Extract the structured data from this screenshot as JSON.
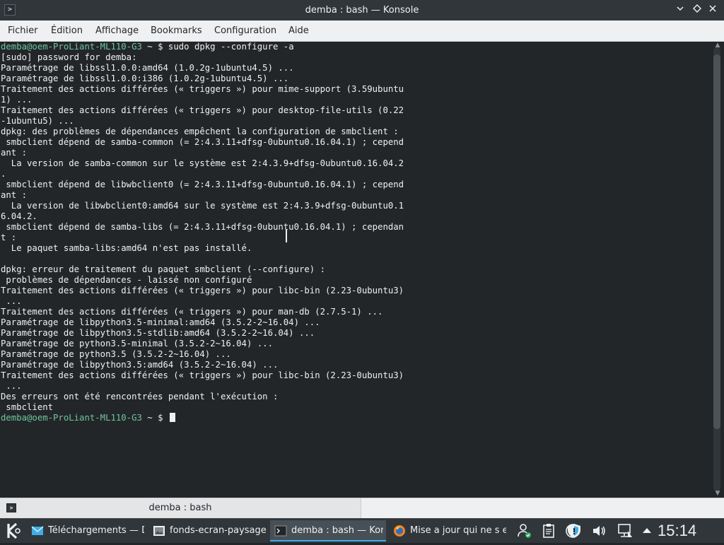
{
  "window": {
    "title": "demba : bash — Konsole",
    "app_icon": "terminal-icon",
    "controls": [
      "chevron-down-icon",
      "keep-above-icon",
      "close-icon"
    ]
  },
  "menubar": {
    "items": [
      "Fichier",
      "Édition",
      "Affichage",
      "Bookmarks",
      "Configuration",
      "Aide"
    ]
  },
  "terminal": {
    "prompt_user_host": "demba@oem-ProLiant-ML110-G3",
    "prompt_suffix": " ~ $ ",
    "command": "sudo dpkg --configure -a",
    "output_lines": [
      "[sudo] password for demba:",
      "Paramétrage de libssl1.0.0:amd64 (1.0.2g-1ubuntu4.5) ...",
      "Paramétrage de libssl1.0.0:i386 (1.0.2g-1ubuntu4.5) ...",
      "Traitement des actions différées (« triggers ») pour mime-support (3.59ubuntu",
      "1) ...",
      "Traitement des actions différées (« triggers ») pour desktop-file-utils (0.22",
      "-1ubuntu5) ...",
      "dpkg: des problèmes de dépendances empêchent la configuration de smbclient :",
      " smbclient dépend de samba-common (= 2:4.3.11+dfsg-0ubuntu0.16.04.1) ; cepend",
      "ant :",
      "  La version de samba-common sur le système est 2:4.3.9+dfsg-0ubuntu0.16.04.2",
      ".",
      " smbclient dépend de libwbclient0 (= 2:4.3.11+dfsg-0ubuntu0.16.04.1) ; cepend",
      "ant :",
      "  La version de libwbclient0:amd64 sur le système est 2:4.3.9+dfsg-0ubuntu0.1",
      "6.04.2.",
      " smbclient dépend de samba-libs (= 2:4.3.11+dfsg-0ubuntu0.16.04.1) ; cependan",
      "t :",
      "  Le paquet samba-libs:amd64 n'est pas installé.",
      "",
      "dpkg: erreur de traitement du paquet smbclient (--configure) :",
      " problèmes de dépendances - laissé non configuré",
      "Traitement des actions différées (« triggers ») pour libc-bin (2.23-0ubuntu3)",
      " ...",
      "Traitement des actions différées (« triggers ») pour man-db (2.7.5-1) ...",
      "Paramétrage de libpython3.5-minimal:amd64 (3.5.2-2~16.04) ...",
      "Paramétrage de libpython3.5-stdlib:amd64 (3.5.2-2~16.04) ...",
      "Paramétrage de python3.5-minimal (3.5.2-2~16.04) ...",
      "Paramétrage de python3.5 (3.5.2-2~16.04) ...",
      "Paramétrage de libpython3.5:amd64 (3.5.2-2~16.04) ...",
      "Traitement des actions différées (« triggers ») pour libc-bin (2.23-0ubuntu3)",
      " ...",
      "Des erreurs ont été rencontrées pendant l'exécution :",
      " smbclient"
    ],
    "colors": {
      "background": "#232629",
      "text": "#eff0f1",
      "prompt": "#6fc59a"
    }
  },
  "tabbar": {
    "tab_label": "demba : bash",
    "tab_icon": "terminal-icon"
  },
  "taskbar": {
    "launcher_icon": "kde-logo-icon",
    "tasks": [
      {
        "label": "Téléchargements — D",
        "icon": "mail-icon",
        "active": false
      },
      {
        "label": "fonds-ecran-paysage",
        "icon": "image-viewer-icon",
        "active": false
      },
      {
        "label": "demba : bash — Kon",
        "icon": "terminal-icon",
        "active": true
      },
      {
        "label": "Mise a jour qui ne s e",
        "icon": "firefox-icon",
        "active": false
      }
    ],
    "tray_icons": [
      "user-status-icon",
      "clipboard-icon",
      "notifications-icon",
      "update-shield-icon",
      "volume-icon",
      "network-icon",
      "tray-expand-icon"
    ],
    "clock": "15:14"
  }
}
